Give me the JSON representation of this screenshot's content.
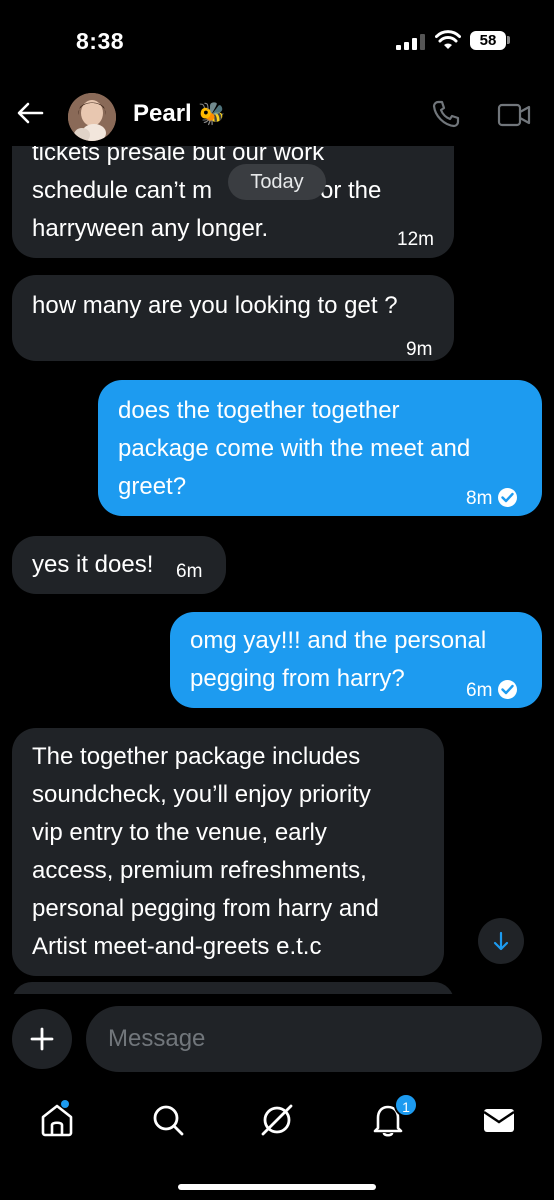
{
  "status_bar": {
    "time": "8:38",
    "battery": "58"
  },
  "header": {
    "contact_name": "Pearl",
    "emoji": "🐝"
  },
  "chat": {
    "date_divider": "Today",
    "messages": [
      {
        "direction": "in",
        "lines": [
          "tickets presale but our work",
          "schedule can’t m",
          "or the",
          "harryween any longer."
        ],
        "time": "12m"
      },
      {
        "direction": "in",
        "lines": [
          "how many are you looking to get ?"
        ],
        "time": "9m"
      },
      {
        "direction": "out",
        "lines": [
          "does the together together",
          "package come with the meet and",
          "greet?"
        ],
        "time": "8m"
      },
      {
        "direction": "in",
        "lines": [
          "yes it does!"
        ],
        "time": "6m"
      },
      {
        "direction": "out",
        "lines": [
          "omg yay!!! and the personal",
          "pegging from harry?"
        ],
        "time": "6m"
      },
      {
        "direction": "in",
        "lines": [
          "The together package includes",
          "soundcheck, you’ll enjoy priority",
          "vip entry to the venue, early",
          "access, premium refreshments,",
          "personal pegging from harry and",
          "Artist meet-and-greets e.t.c"
        ]
      }
    ]
  },
  "composer": {
    "placeholder": "Message"
  },
  "nav": {
    "notifications_count": "1"
  },
  "colors": {
    "accent": "#1d9bf0",
    "incoming_bubble": "#202327",
    "background": "#000000"
  }
}
